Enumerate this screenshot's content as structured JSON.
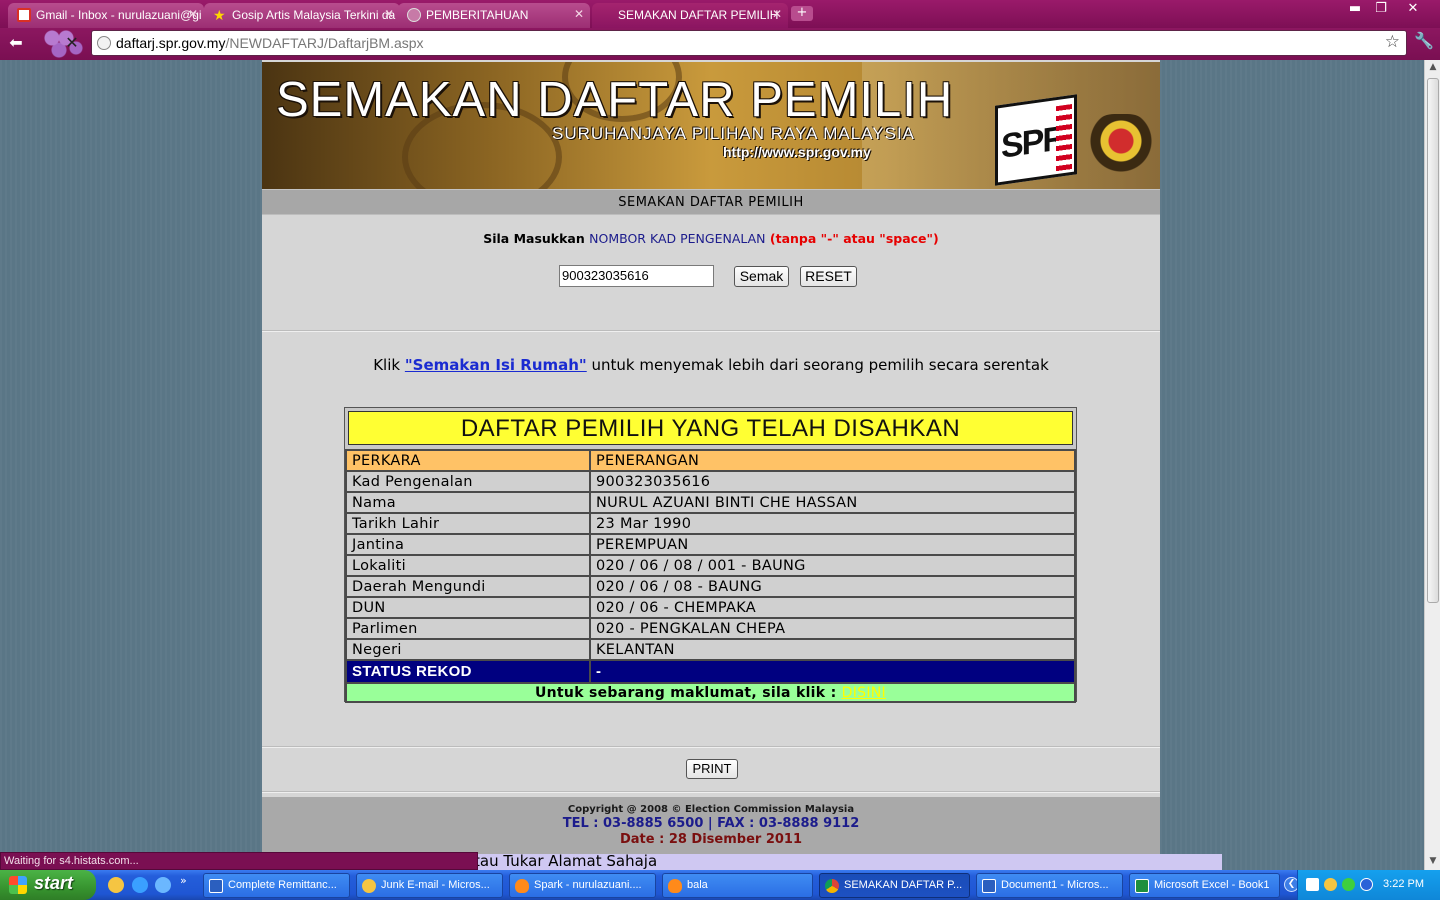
{
  "browser": {
    "tabs": [
      {
        "label": "Gmail - Inbox - nurulazuani@gi",
        "icon": "gmail-icon",
        "active": false
      },
      {
        "label": "Gosip Artis Malaysia Terkini da",
        "icon": "star-icon",
        "active": false
      },
      {
        "label": "PEMBERITAHUAN",
        "icon": "page-icon",
        "active": false
      },
      {
        "label": "SEMAKAN DAFTAR PEMILIH",
        "icon": "page-icon",
        "active": true
      }
    ],
    "url_host": "daftarj.spr.gov.my",
    "url_path": "/NEWDAFTARJ/DaftarjBM.aspx",
    "status_text": "Waiting for s4.histats.com..."
  },
  "banner": {
    "title": "SEMAKAN DAFTAR PEMILIH",
    "subtitle": "SURUHANJAYA PILIHAN RAYA MALAYSIA",
    "url": "http://www.spr.gov.my",
    "logo_text": "SPR"
  },
  "form": {
    "header": "SEMAKAN DAFTAR PEMILIH",
    "prompt_prefix": "Sila Masukkan",
    "prompt_field": "NOMBOR KAD PENGENALAN",
    "prompt_hint": "(tanpa \"-\" atau \"space\")",
    "ic_value": "900323035616",
    "semak_label": "Semak",
    "reset_label": "RESET"
  },
  "klik": {
    "prefix": "Klik",
    "link": "\"Semakan Isi Rumah\"",
    "suffix": "untuk menyemak lebih dari seorang pemilih secara serentak"
  },
  "result": {
    "title": "DAFTAR PEMILIH YANG TELAH DISAHKAN",
    "col1": "PERKARA",
    "col2": "PENERANGAN",
    "rows": [
      {
        "k": "Kad Pengenalan",
        "v": "900323035616"
      },
      {
        "k": "Nama",
        "v": "NURUL AZUANI BINTI CHE HASSAN"
      },
      {
        "k": "Tarikh Lahir",
        "v": "23 Mar 1990"
      },
      {
        "k": "Jantina",
        "v": "PEREMPUAN"
      },
      {
        "k": "Lokaliti",
        "v": "020 / 06 / 08 / 001 - BAUNG"
      },
      {
        "k": "Daerah Mengundi",
        "v": "020 / 06 / 08 - BAUNG"
      },
      {
        "k": "DUN",
        "v": "020 / 06 - CHEMPAKA"
      },
      {
        "k": "Parlimen",
        "v": "020 - PENGKALAN CHEPA"
      },
      {
        "k": "Negeri",
        "v": "KELANTAN"
      }
    ],
    "status_label": "STATUS REKOD",
    "status_value": "-",
    "info_text": "Untuk sebarang maklumat, sila klik :",
    "info_link": "DISINI"
  },
  "print_label": "PRINT",
  "footer": {
    "copyright": "Copyright @ 2008 © Election Commission Malaysia",
    "tel": "TEL : 03-8885 6500 | FAX : 03-8888 9112",
    "date": "Date : 28 Disember 2011",
    "marquee": "tau Tukar Alamat Sahaja"
  },
  "taskbar": {
    "start_label": "start",
    "tasks": [
      {
        "label": "Complete Remittanc...",
        "icon": "word-icon"
      },
      {
        "label": "Junk E-mail - Micros...",
        "icon": "outlook-icon"
      },
      {
        "label": "Spark - nurulazuani....",
        "icon": "spark-icon"
      },
      {
        "label": "bala",
        "icon": "spark-icon"
      },
      {
        "label": "SEMAKAN DAFTAR P...",
        "icon": "chrome-icon"
      },
      {
        "label": "Document1 - Micros...",
        "icon": "word-icon"
      },
      {
        "label": "Microsoft Excel - Book1",
        "icon": "excel-icon"
      }
    ],
    "clock": "3:22 PM"
  }
}
